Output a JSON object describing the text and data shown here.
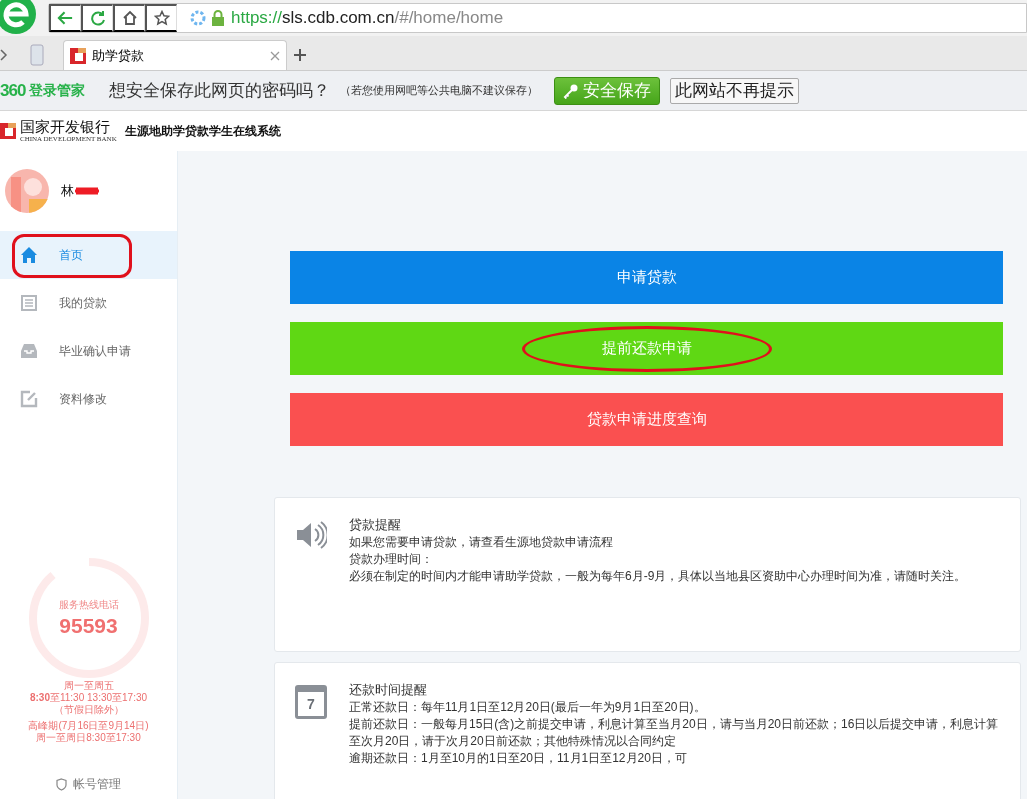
{
  "browser": {
    "url_scheme": "https://",
    "url_host": "sls.cdb.com.cn",
    "url_path": "/#/home/home",
    "tabs": [
      {
        "title": "助学贷款",
        "selected": true
      }
    ]
  },
  "password_bar": {
    "brand": "360",
    "brand_label": "登录管家",
    "question": "想安全保存此网页的密码吗？",
    "note": "（若您使用网吧等公共电脑不建议保存）",
    "save_button": "安全保存",
    "dismiss_button": "此网站不再提示"
  },
  "header": {
    "bank_name": "国家开发银行",
    "bank_name_en": "CHINA DEVELOPMENT BANK",
    "system_title": "生源地助学贷款学生在线系统"
  },
  "sidebar": {
    "user_name": "林",
    "nav": [
      {
        "label": "首页",
        "kind": "home",
        "selected": true,
        "circled": true
      },
      {
        "label": "我的贷款",
        "kind": "list",
        "selected": false,
        "circled": false
      },
      {
        "label": "毕业确认申请",
        "kind": "inbox",
        "selected": false,
        "circled": false
      },
      {
        "label": "资料修改",
        "kind": "edit",
        "selected": false,
        "circled": false
      }
    ],
    "hotline": {
      "title": "服务热线电话",
      "number": "95593",
      "hours": [
        "周一至周五",
        "**8:30**至11:30 13:30至17:30",
        "（节假日除外）",
        "高峰期(7月16日至9月14日)",
        "周一至周日8:30至17:30"
      ]
    },
    "account_link": "帐号管理"
  },
  "actions": [
    {
      "label": "申请贷款",
      "color": "#0a84e6",
      "circled": false
    },
    {
      "label": "提前还款申请",
      "color": "#5fd814",
      "circled": true
    },
    {
      "label": "贷款申请进度查询",
      "color": "#fa5050",
      "circled": false
    }
  ],
  "notices": [
    {
      "kind": "speaker",
      "title": "贷款提醒",
      "lines": [
        "如果您需要申请贷款，请查看生源地贷款申请流程",
        "贷款办理时间：",
        "必须在制定的时间内才能申请助学贷款，一般为每年6月-9月，具体以当地县区资助中心办理时间为准，请随时关注。"
      ]
    },
    {
      "kind": "calendar",
      "icon_text": "7",
      "title": "还款时间提醒",
      "lines": [
        "正常还款日：每年11月1日至12月20日(最后一年为9月1日至20日)。",
        "提前还款日：一般每月15日(含)之前提交申请，利息计算至当月20日，请与当月20日前还款；16日以后提交申请，利息计算至次月20日，请于次月20日前还款；其他特殊情况以合同约定",
        "逾期还款日：1月至10月的1日至20日，11月1日至12月20日，可"
      ]
    }
  ]
}
